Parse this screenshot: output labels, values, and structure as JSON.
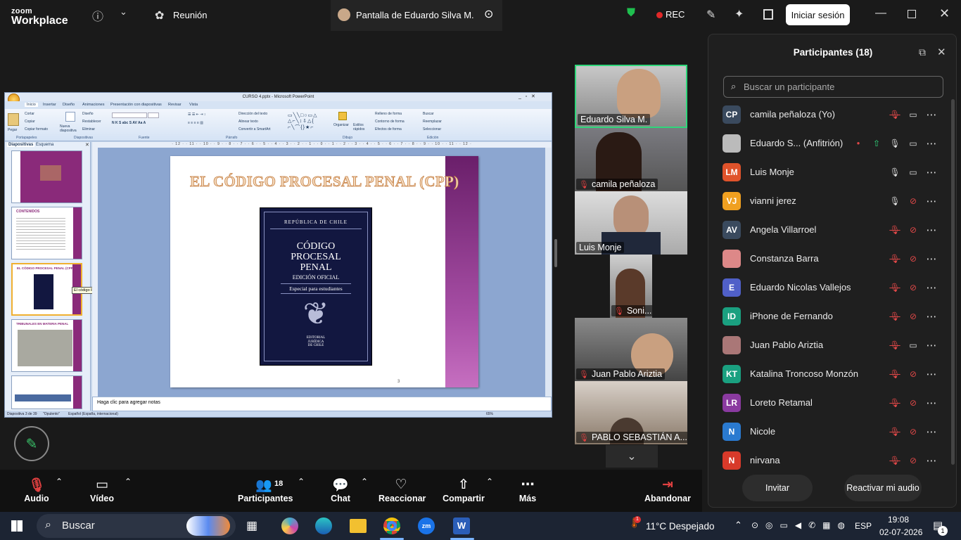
{
  "app": {
    "logo_line1": "zoom",
    "logo_line2": "Workplace",
    "meeting_label": "Reunión",
    "share_tab": "Pantalla de Eduardo Silva M.",
    "rec": "REC",
    "signin": "Iniciar sesión"
  },
  "ppt": {
    "window_title": "CURSO 4.pptx - Microsoft PowerPoint",
    "tabs": [
      "Inicio",
      "Insertar",
      "Diseño",
      "Animaciones",
      "Presentación con diapositivas",
      "Revisar",
      "Vista"
    ],
    "groups": [
      "Portapapeles",
      "Diapositivas",
      "Fuente",
      "Párrafo",
      "Dibujo",
      "Edición"
    ],
    "clip": [
      "Cortar",
      "Copiar",
      "Copiar formato"
    ],
    "paste": "Pegar",
    "newslide": "Nueva diapositiva",
    "slides_items": [
      "Diseño",
      "Restablecer",
      "Eliminar"
    ],
    "para_items": [
      "Dirección del texto",
      "Alinear texto",
      "Convertir a SmartArt"
    ],
    "draw_items": [
      "Organizar",
      "Estilos rápidos",
      "Relleno de forma",
      "Contorno de forma",
      "Efectos de forma"
    ],
    "edit_items": [
      "Buscar",
      "Reemplazar",
      "Seleccionar"
    ],
    "pane_tabs": [
      "Diapositivas",
      "Esquema"
    ],
    "slide_title": "EL CÓDIGO PROCESAL PENAL (CPP)",
    "book": {
      "top": "REPÚBLICA DE CHILE",
      "l1": "CÓDIGO",
      "l2": "PROCESAL",
      "l3": "PENAL",
      "ed": "EDICIÓN OFICIAL",
      "sub": "Especial para estudiantes",
      "pub1": "EDITORIAL",
      "pub2": "JURÍDICA",
      "pub3": "DE CHILE"
    },
    "slide_num": "3",
    "tooltip": "El código Procesal Penal (cpp)",
    "thumb_titles": [
      "",
      "CONTENIDOS",
      "EL CÓDIGO PROCESAL PENAL (CPP)",
      "TRIBUNALES EN MATERIA PENAL",
      ""
    ],
    "notes": "Haga clic para agregar notas",
    "status": [
      "Diapositiva 3 de 39",
      "\"Opulento\"",
      "Español (España, internacional)",
      "65%"
    ]
  },
  "gallery": [
    {
      "name": "Eduardo Silva M."
    },
    {
      "name": "camila peñaloza"
    },
    {
      "name": "Luis Monje"
    },
    {
      "name": "Soni..."
    },
    {
      "name": "Juan Pablo Ariztia"
    },
    {
      "name": "PABLO SEBASTIÁN A..."
    }
  ],
  "panel": {
    "title": "Participantes (18)",
    "search_placeholder": "Buscar un participante",
    "invite": "Invitar",
    "unmute": "Reactivar mi audio",
    "participants": [
      {
        "initials": "CP",
        "name": "camila peñaloza (Yo)",
        "color": "#3a4a5e",
        "mic": "off",
        "cam": "on"
      },
      {
        "initials": "",
        "name": "Eduardo S... (Anfitrión)",
        "color": "#bbb",
        "mic": "on",
        "cam": "on",
        "sharing": true
      },
      {
        "initials": "LM",
        "name": "Luis Monje",
        "color": "#e0532b",
        "mic": "on",
        "cam": "on"
      },
      {
        "initials": "VJ",
        "name": "vianni jerez",
        "color": "#f0a020",
        "mic": "on",
        "cam": "off"
      },
      {
        "initials": "AV",
        "name": "Angela Villarroel",
        "color": "#3a4a5e",
        "mic": "off",
        "cam": "off"
      },
      {
        "initials": "",
        "name": "Constanza Barra",
        "color": "#d88",
        "mic": "off",
        "cam": "off"
      },
      {
        "initials": "E",
        "name": "Eduardo Nicolas Vallejos",
        "color": "#5060c8",
        "mic": "off",
        "cam": "off"
      },
      {
        "initials": "ID",
        "name": "iPhone de Fernando",
        "color": "#1aa080",
        "mic": "off",
        "cam": "off"
      },
      {
        "initials": "",
        "name": "Juan Pablo Ariztia",
        "color": "#a77",
        "mic": "off",
        "cam": "on"
      },
      {
        "initials": "KT",
        "name": "Katalina Troncoso Monzón",
        "color": "#1aa080",
        "mic": "off",
        "cam": "off"
      },
      {
        "initials": "LR",
        "name": "Loreto Retamal",
        "color": "#8a3aa0",
        "mic": "off",
        "cam": "off"
      },
      {
        "initials": "N",
        "name": "Nicole",
        "color": "#2a7ad0",
        "mic": "off",
        "cam": "off"
      },
      {
        "initials": "N",
        "name": "nirvana",
        "color": "#d83a2a",
        "mic": "off",
        "cam": "off"
      }
    ]
  },
  "toolbar": {
    "audio": "Audio",
    "video": "Vídeo",
    "participants": "Participantes",
    "participants_count": "18",
    "chat": "Chat",
    "react": "Reaccionar",
    "share": "Compartir",
    "more": "Más",
    "leave": "Abandonar"
  },
  "taskbar": {
    "search": "Buscar",
    "weather": "11°C  Despejado",
    "lang": "ESP",
    "time": "19:08",
    "date": "02-07-2026",
    "weather_badge": "1",
    "notif_badge": "1"
  }
}
